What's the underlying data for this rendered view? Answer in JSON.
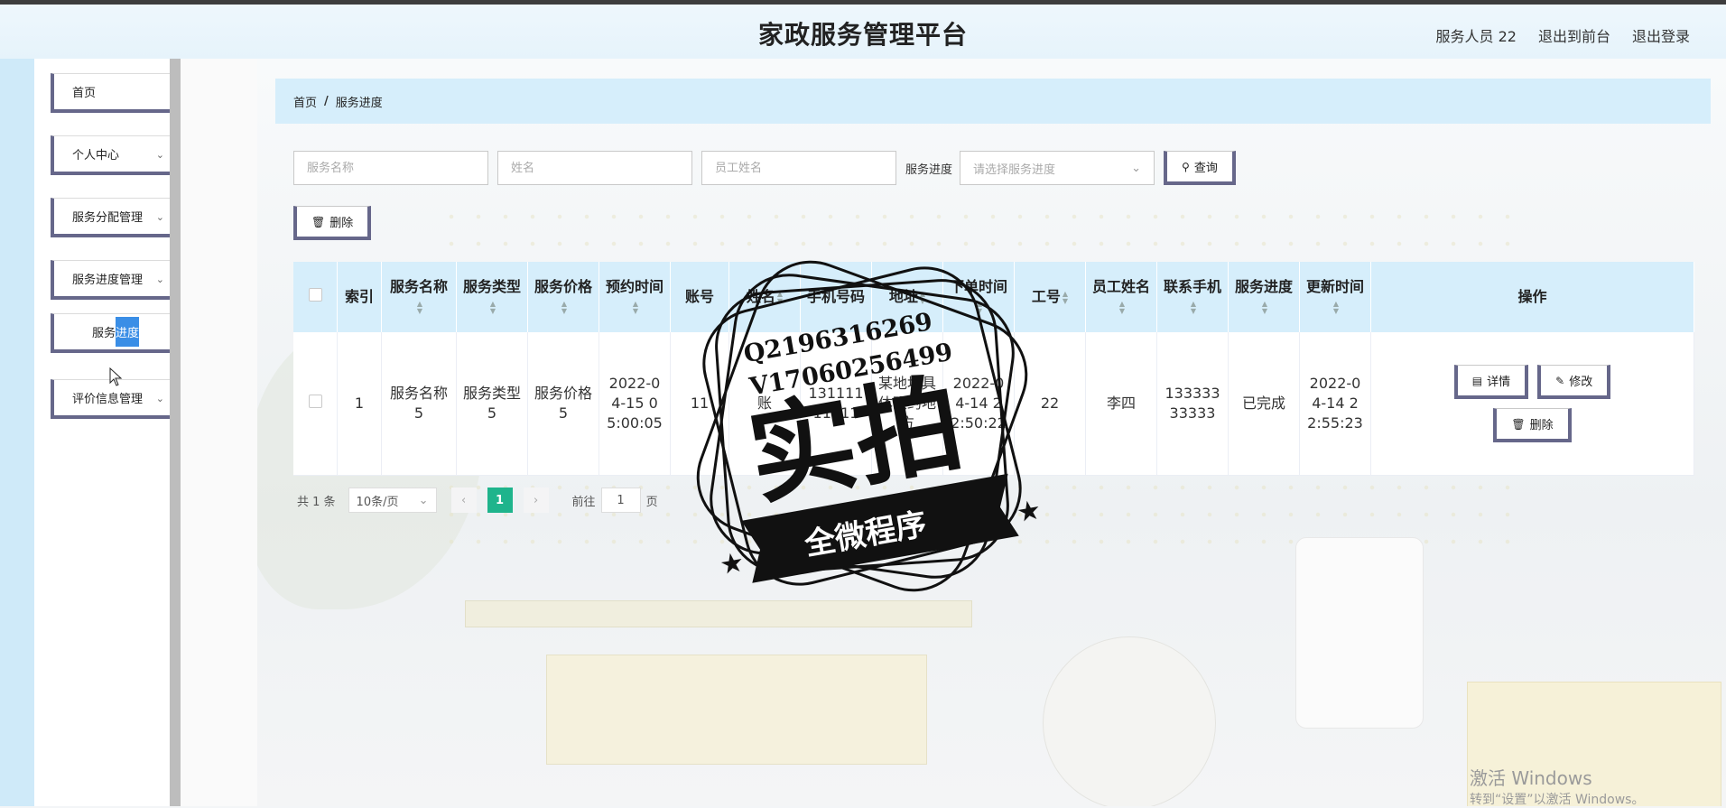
{
  "header": {
    "title": "家政服务管理平台",
    "user": "服务人员 22",
    "back_front": "退出到前台",
    "logout": "退出登录"
  },
  "sidebar": {
    "items": [
      {
        "label": "首页"
      },
      {
        "label": "个人中心"
      },
      {
        "label": "服务分配管理"
      },
      {
        "label": "服务进度管理"
      },
      {
        "label": "评价信息管理"
      }
    ],
    "sub_item": {
      "pre": "服务",
      "highlighted": "进度"
    }
  },
  "breadcrumb": {
    "home": "首页",
    "sep": "/",
    "current": "服务进度"
  },
  "search": {
    "service_name_placeholder": "服务名称",
    "name_placeholder": "姓名",
    "staff_name_placeholder": "员工姓名",
    "progress_label": "服务进度",
    "progress_placeholder": "请选择服务进度",
    "query_button": "查询"
  },
  "delete_button": "删除",
  "table": {
    "headers": {
      "index": "索引",
      "service_name": "服务名称",
      "service_type": "服务类型",
      "service_price": "服务价格",
      "booking_time": "预约时间",
      "account": "账号",
      "name": "姓名",
      "phone": "手机号码",
      "address": "地址",
      "order_time": "下单时间",
      "staff_id": "工号",
      "staff_name": "员工姓名",
      "contact_phone": "联系手机",
      "progress": "服务进度",
      "update_time": "更新时间",
      "actions": "操作"
    },
    "rows": [
      {
        "index": "1",
        "service_name": "服务名称5",
        "service_type": "服务类型5",
        "service_price": "服务价格5",
        "booking_time": "2022-04-15 05:00:05",
        "account": "11",
        "name": "账",
        "phone": "13111111111",
        "address": "某地址具体预约地方",
        "order_time": "2022-04-14 22:50:22",
        "staff_id": "22",
        "staff_name": "李四",
        "contact_phone": "13333333333",
        "progress": "已完成",
        "update_time": "2022-04-14 22:55:23",
        "actions": {
          "detail": "详情",
          "edit": "修改",
          "delete": "删除"
        }
      }
    ]
  },
  "pagination": {
    "total": "共 1 条",
    "page_size": "10条/页",
    "current": "1",
    "goto": "前往",
    "goto_value": "1",
    "page": "页"
  },
  "stamp": {
    "line1": "Q2196316269",
    "line2": "V17060256499",
    "big": "实拍",
    "banner": "全微程序"
  },
  "watermark": {
    "line1": "激活 Windows",
    "line2": "转到“设置”以激活 Windows。"
  },
  "icons": {
    "chevron": "chevron-down-icon",
    "search": "search-icon",
    "trash": "trash-icon",
    "doc": "document-icon",
    "pencil": "pencil-icon"
  }
}
